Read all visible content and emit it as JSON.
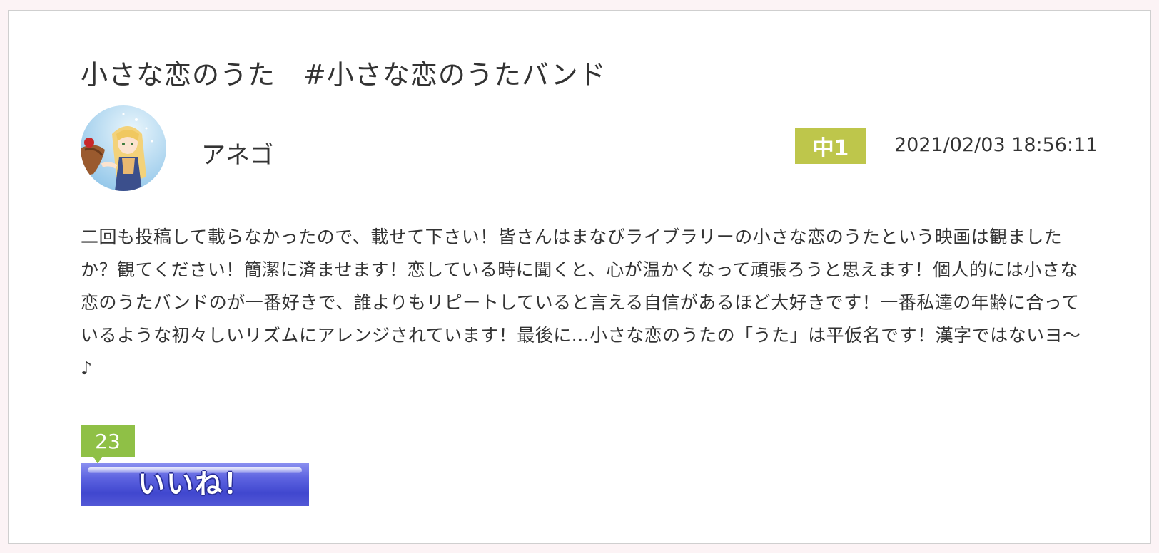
{
  "post": {
    "title": "小さな恋のうた　#小さな恋のうたバンド",
    "author": "アネゴ",
    "grade": "中1",
    "timestamp": "2021/02/03 18:56:11",
    "body": "二回も投稿して載らなかったので、載せて下さい！皆さんはまなびライブラリーの小さな恋のうたという映画は観ましたか？観てください！簡潔に済ませます！恋している時に聞くと、心が温かくなって頑張ろうと思えます！個人的には小さな恋のうたバンドのが一番好きで、誰よりもリピートしていると言える自信があるほど大好きです！一番私達の年齢に合っているような初々しいリズムにアレンジされています！最後に...小さな恋のうたの「うた」は平仮名です！漢字ではないヨ〜♪"
  },
  "like": {
    "count": "23",
    "label": "いいね！"
  },
  "colors": {
    "grade_badge": "#bec64b",
    "like_count_badge": "#8fc046",
    "like_button": "#4a51d8",
    "page_background": "#fcf3f5"
  }
}
